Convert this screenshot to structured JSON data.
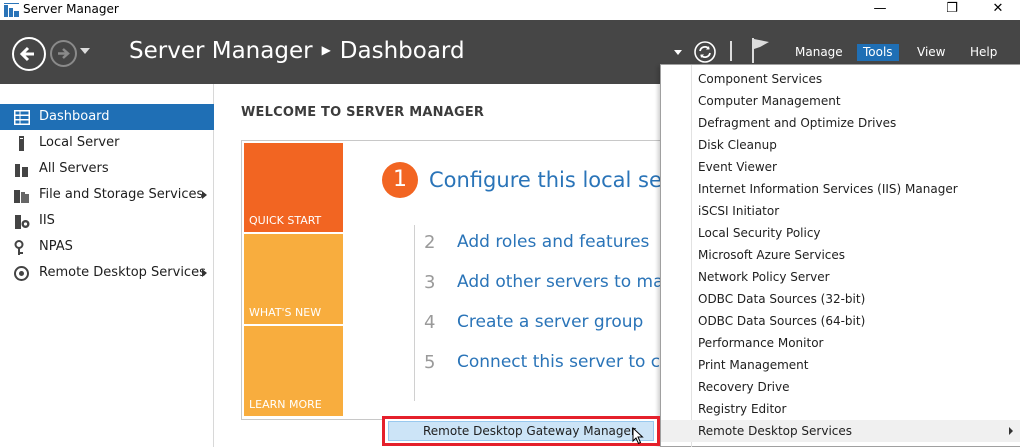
{
  "window": {
    "title": "Server Manager",
    "controls": {
      "minimize": "—",
      "maximize": "❐",
      "close": "✕"
    }
  },
  "header": {
    "breadcrumb": {
      "app": "Server Manager",
      "page": "Dashboard"
    },
    "menu": [
      {
        "label": "Manage",
        "active": false
      },
      {
        "label": "Tools",
        "active": true
      },
      {
        "label": "View",
        "active": false
      },
      {
        "label": "Help",
        "active": false
      }
    ]
  },
  "sidebar": {
    "items": [
      {
        "label": "Dashboard",
        "icon": "dashboard-icon",
        "active": true,
        "has_arrow": false
      },
      {
        "label": "Local Server",
        "icon": "server-icon",
        "active": false,
        "has_arrow": false
      },
      {
        "label": "All Servers",
        "icon": "servers-icon",
        "active": false,
        "has_arrow": false
      },
      {
        "label": "File and Storage Services",
        "icon": "storage-icon",
        "active": false,
        "has_arrow": true
      },
      {
        "label": "IIS",
        "icon": "iis-icon",
        "active": false,
        "has_arrow": false
      },
      {
        "label": "NPAS",
        "icon": "npas-icon",
        "active": false,
        "has_arrow": false
      },
      {
        "label": "Remote Desktop Services",
        "icon": "rds-icon",
        "active": false,
        "has_arrow": true
      }
    ]
  },
  "main": {
    "welcome": "WELCOME TO SERVER MANAGER",
    "tiles": {
      "quick_start": "QUICK START",
      "whats_new": "WHAT'S NEW",
      "learn_more": "LEARN MORE"
    },
    "step1": {
      "num": "1",
      "text": "Configure this local ser"
    },
    "steps": [
      {
        "num": "2",
        "text": "Add roles and features"
      },
      {
        "num": "3",
        "text": "Add other servers to mana"
      },
      {
        "num": "4",
        "text": "Create a server group"
      },
      {
        "num": "5",
        "text": "Connect this server to clou"
      }
    ]
  },
  "tools_menu": {
    "items": [
      {
        "label": "Component Services",
        "has_submenu": false,
        "hover": false
      },
      {
        "label": "Computer Management",
        "has_submenu": false,
        "hover": false
      },
      {
        "label": "Defragment and Optimize Drives",
        "has_submenu": false,
        "hover": false
      },
      {
        "label": "Disk Cleanup",
        "has_submenu": false,
        "hover": false
      },
      {
        "label": "Event Viewer",
        "has_submenu": false,
        "hover": false
      },
      {
        "label": "Internet Information Services (IIS) Manager",
        "has_submenu": false,
        "hover": false
      },
      {
        "label": "iSCSI Initiator",
        "has_submenu": false,
        "hover": false
      },
      {
        "label": "Local Security Policy",
        "has_submenu": false,
        "hover": false
      },
      {
        "label": "Microsoft Azure Services",
        "has_submenu": false,
        "hover": false
      },
      {
        "label": "Network Policy Server",
        "has_submenu": false,
        "hover": false
      },
      {
        "label": "ODBC Data Sources (32-bit)",
        "has_submenu": false,
        "hover": false
      },
      {
        "label": "ODBC Data Sources (64-bit)",
        "has_submenu": false,
        "hover": false
      },
      {
        "label": "Performance Monitor",
        "has_submenu": false,
        "hover": false
      },
      {
        "label": "Print Management",
        "has_submenu": false,
        "hover": false
      },
      {
        "label": "Recovery Drive",
        "has_submenu": false,
        "hover": false
      },
      {
        "label": "Registry Editor",
        "has_submenu": false,
        "hover": false
      },
      {
        "label": "Remote Desktop Services",
        "has_submenu": true,
        "hover": true
      }
    ]
  },
  "submenu": {
    "item": "Remote Desktop Gateway Manager"
  },
  "colors": {
    "header_bg": "#464646",
    "accent_blue": "#1f6fb5",
    "link_blue": "#2a74b8",
    "quick_start_orange": "#f26522",
    "tile_orange": "#f8ad3e",
    "highlight_red": "#e5202b"
  }
}
